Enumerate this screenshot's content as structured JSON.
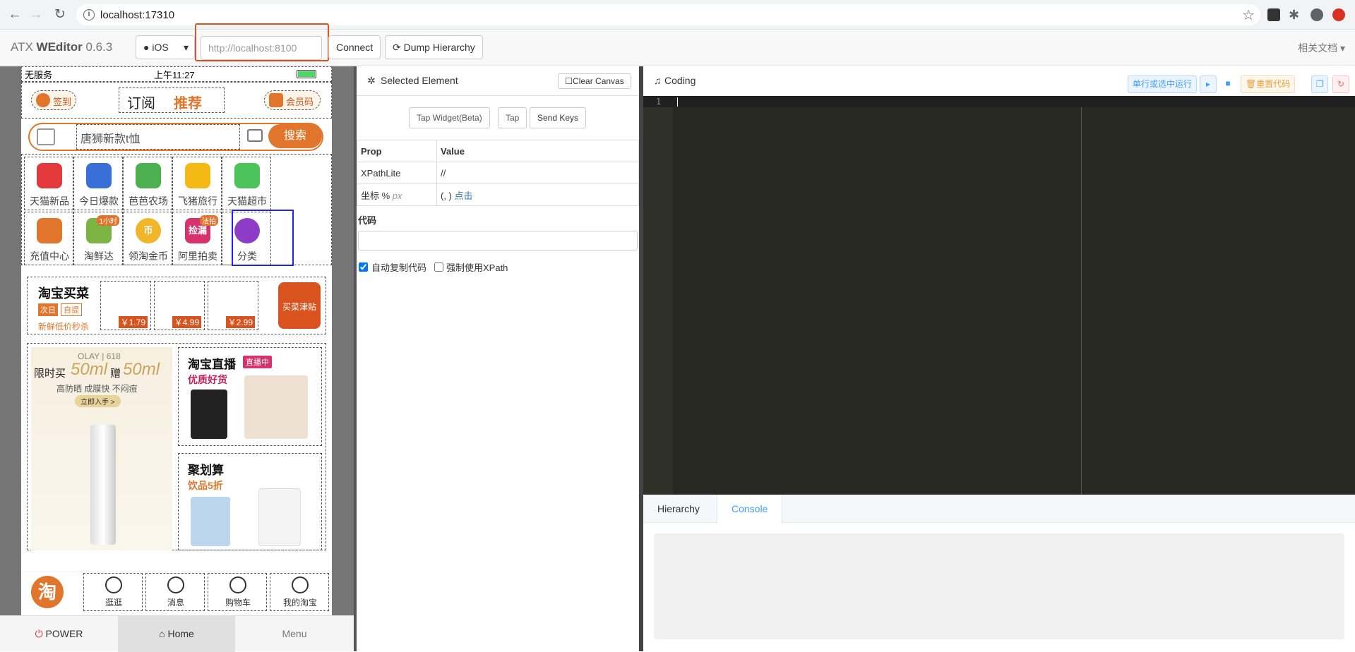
{
  "browser": {
    "url": "localhost:17310",
    "icons": [
      "back-icon",
      "forward-icon",
      "reload-icon",
      "info-icon",
      "star-icon",
      "extension-icon",
      "puzzle-icon",
      "profile-icon",
      "update-icon"
    ]
  },
  "app": {
    "brand_prefix": "ATX",
    "brand_name": "WEditor",
    "version": "0.6.3",
    "platform": "iOS",
    "address_placeholder": "http://localhost:8100",
    "connect_label": "Connect",
    "dump_label": "Dump Hierarchy",
    "docs_label": "相关文档",
    "accent_color": "#409eff"
  },
  "device": {
    "status": {
      "carrier": "无服务",
      "time": "上午11:27"
    },
    "top_nav": {
      "checkin": "签到",
      "subscribe": "订阅",
      "recommend": "推荐",
      "member": "会员码"
    },
    "search": {
      "placeholder": "唐狮新款t恤",
      "button": "搜索"
    },
    "grid": [
      {
        "label": "天猫新品",
        "icon": "tmall-new-icon"
      },
      {
        "label": "今日爆款",
        "icon": "hot-deal-icon"
      },
      {
        "label": "芭芭农场",
        "icon": "farm-icon"
      },
      {
        "label": "飞猪旅行",
        "icon": "travel-icon"
      },
      {
        "label": "天猫超市",
        "icon": "supermarket-icon"
      },
      {
        "label": "充值中心",
        "icon": "recharge-icon"
      },
      {
        "label": "淘鲜达",
        "icon": "fresh-icon",
        "badge": "1小时"
      },
      {
        "label": "领淘金币",
        "icon": "coin-icon",
        "glyph": "币"
      },
      {
        "label": "阿里拍卖",
        "icon": "auction-icon",
        "badge": "法拍",
        "glyph": "捡漏"
      },
      {
        "label": "分类",
        "icon": "category-icon"
      }
    ],
    "grocery": {
      "title": "淘宝买菜",
      "tag1": "次日",
      "tag2": "自提",
      "subtitle": "新鲜低价秒杀",
      "prices": [
        "￥1.79",
        "￥4.99",
        "￥2.99"
      ],
      "promo": "买菜津贴"
    },
    "ad": {
      "brand": "OLAY | 618",
      "headline_a": "限时买",
      "headline_b": "50ml",
      "headline_c": "赠",
      "headline_d": "50ml",
      "sub": "高防晒 成膜快 不闷痘",
      "cta": "立即入手 >"
    },
    "live": {
      "title": "淘宝直播",
      "badge": "直播中",
      "sub": "优质好货"
    },
    "juhuasuan": {
      "title": "聚划算",
      "sub": "饮品5折"
    },
    "tabbar": [
      "逛逛",
      "消息",
      "购物车",
      "我的淘宝"
    ],
    "tabbar_logo": "淘",
    "buttons": {
      "power": "POWER",
      "home": "Home",
      "menu": "Menu"
    }
  },
  "inspector": {
    "title": "Selected Element",
    "clear_label": "Clear Canvas",
    "actions": [
      "Tap Widget(Beta)",
      "Tap",
      "Send Keys"
    ],
    "table_headers": [
      "Prop",
      "Value"
    ],
    "rows": [
      {
        "prop": "XPathLite",
        "value": "//"
      },
      {
        "prop": "坐标 %",
        "prop_suffix": "px",
        "value": "(, )",
        "link": "点击"
      }
    ],
    "code_label": "代码",
    "code_value": "",
    "checkbox_auto_copy": {
      "label": "自动复制代码",
      "checked": true
    },
    "checkbox_force_xpath": {
      "label": "强制使用XPath",
      "checked": false
    }
  },
  "coding": {
    "title": "Coding",
    "run_label": "单行或选中运行",
    "reset_label": "重置代码",
    "line_number": "1",
    "tabs": [
      "Hierarchy",
      "Console"
    ],
    "active_tab": "Console"
  }
}
